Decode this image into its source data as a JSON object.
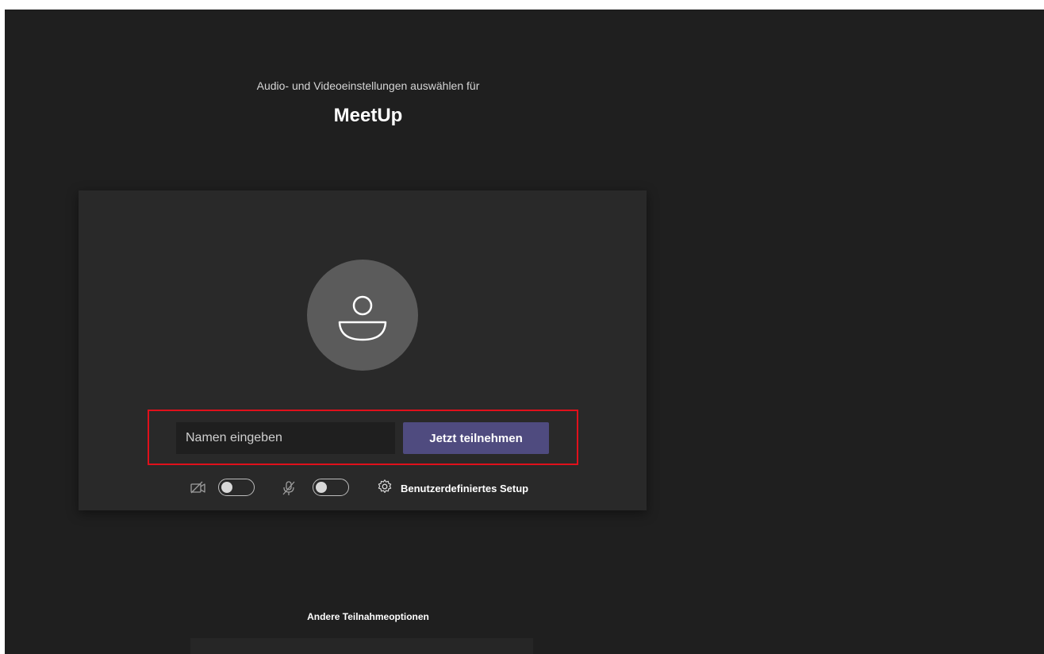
{
  "header": {
    "subtitle": "Audio- und Videoeinstellungen auswählen für",
    "meeting_title": "MeetUp"
  },
  "prejoin": {
    "avatar_icon": "person-icon",
    "name_input": {
      "placeholder": "Namen eingeben",
      "value": ""
    },
    "join_button_label": "Jetzt teilnehmen",
    "controls": {
      "camera": {
        "icon": "camera-off-icon",
        "state": "off"
      },
      "microphone": {
        "icon": "mic-off-icon",
        "state": "off"
      },
      "setup_icon": "gear-icon",
      "setup_label": "Benutzerdefiniertes Setup"
    }
  },
  "footer": {
    "other_options_label": "Andere Teilnahmeoptionen"
  },
  "colors": {
    "background": "#1f1f1f",
    "panel": "#292929",
    "accent": "#4f4b7f",
    "highlight_border": "#e0101b"
  }
}
